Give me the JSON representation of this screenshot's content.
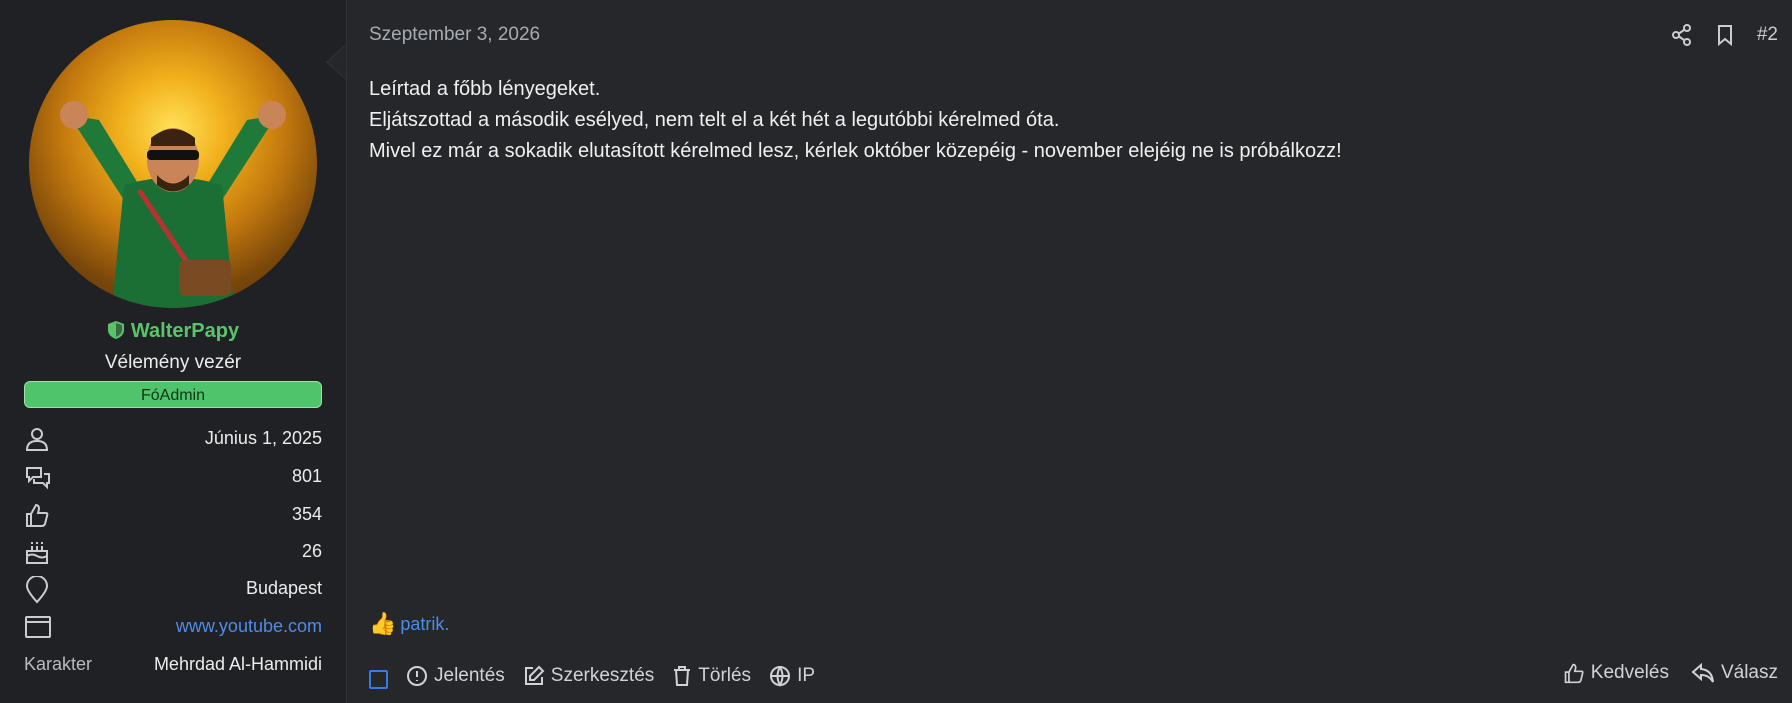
{
  "user": {
    "username": "WalterPapy",
    "title": "Vélemény vezér",
    "role": "FóAdmin",
    "stats": [
      {
        "icon": "user-icon",
        "value": "Június 1, 2025"
      },
      {
        "icon": "messages-icon",
        "value": "801"
      },
      {
        "icon": "thumbs-up-icon",
        "value": "354"
      },
      {
        "icon": "birthday-cake-icon",
        "value": "26"
      },
      {
        "icon": "location-pin-icon",
        "value": "Budapest"
      },
      {
        "icon": "website-icon",
        "value": "www.youtube.com"
      }
    ],
    "character": {
      "label": "Karakter",
      "value": "Mehrdad Al-Hammidi"
    }
  },
  "post": {
    "date": "Szeptember 3, 2026",
    "number": "#2",
    "lines": [
      "Leírtad a főbb lényegeket.",
      "Eljátszottad a második esélyed, nem telt el a két hét a legutóbbi kérelmed óta.",
      "Mivel ez már a sokadik elutasított kérelmed lesz, kérlek október közepéig - november elejéig ne is próbálkozz!"
    ],
    "reaction_user": "patrik."
  },
  "actions": {
    "report": "Jelentés",
    "edit": "Szerkesztés",
    "delete": "Törlés",
    "ip": "IP",
    "like": "Kedvelés",
    "reply": "Válasz"
  },
  "colors": {
    "accent": "#4f8ce8",
    "role_badge": "#4fc46a",
    "username": "#5bc46a"
  }
}
